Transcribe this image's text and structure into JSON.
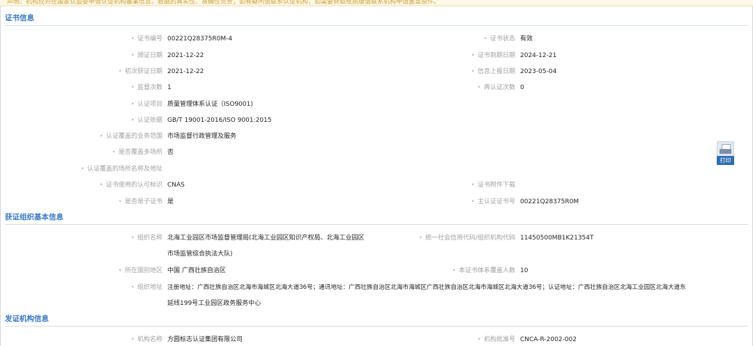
{
  "notice_text": "声明：机构应对在国家认监委申请认证机构备案信息，数据的真实性、准确性负责；如有疑问请联系认证机构；如需要获取纸质版请联系机构申请盖章原件。",
  "sections": {
    "cert": "证书信息",
    "org": "获证组织基本信息",
    "issuer": "发证机构信息"
  },
  "cert": {
    "cert_no_label": "证书编号",
    "cert_no": "00221Q28375R0M-4",
    "status_label": "证书状态",
    "status": "有效",
    "issue_date_label": "颁证日期",
    "issue_date": "2021-12-22",
    "expire_date_label": "证书到期日期",
    "expire_date": "2024-12-21",
    "first_date_label": "初次获证日期",
    "first_date": "2021-12-22",
    "report_date_label": "信息上报日期",
    "report_date": "2023-05-04",
    "surveil_label": "监督次数",
    "surveil": "1",
    "recert_label": "再认证次数",
    "recert": "0",
    "project_label": "认证项目",
    "project": "质量管理体系认证（ISO9001)",
    "basis_label": "认证依据",
    "basis": "GB/T 19001-2016/ISO 9001:2015",
    "scope_label": "认证覆盖的业务范围",
    "scope": "市场监督行政管理及服务",
    "multisite_label": "是否覆盖多场所",
    "multisite": "否",
    "sites_label": "认证覆盖的场所名称及地址",
    "sites": "",
    "mark_label": "证书使用的认可标识",
    "mark": "CNAS",
    "attach_label": "证书附件下载",
    "attach": "",
    "sub_label": "是否是子证书",
    "sub": "是",
    "main_cert_label": "主认证证书号",
    "main_cert": "00221Q28375R0M"
  },
  "org": {
    "name_label": "组织名称",
    "name_line1": "北海工业园区市场监督管理局(北海工业园区知识产权局、北海工业园区",
    "name_line2": "市场监管综合执法大队)",
    "credit_label": "统一社会信用代码/组织机构代码",
    "credit": "11450500MB1K21354T",
    "region_label": "所在国别地区",
    "region": "中国 广西壮族自治区",
    "people_label": "本证书体系覆盖人数",
    "people": "10",
    "address_label": "组织地址",
    "address_line1": "注册地址：广西壮族自治区北海市海城区北海大道36号；通讯地址：广西壮族自治区北海市海城区广西壮族自治区北海市海城区北海大道36号；认证地址：广西壮族自治区北海工业园区北海大道东",
    "address_line2": "延线199号工业园区政务服务中心"
  },
  "issuer": {
    "name_label": "机构名称",
    "name": "方圆标志认证集团有限公司",
    "approval_label": "机构批准号",
    "approval": "CNCA-R-2002-002"
  },
  "print_label": "打印",
  "colors": {
    "section_title": "#3a78c2",
    "label": "#a0a0a0",
    "print_button": "#2f6db3"
  }
}
